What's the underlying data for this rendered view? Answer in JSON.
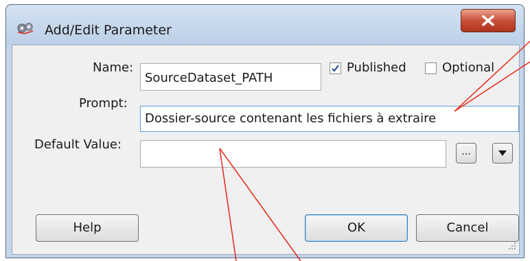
{
  "window": {
    "title": "Add/Edit Parameter",
    "close_glyph": "x"
  },
  "form": {
    "name_label": "Name:",
    "name_value": "SourceDataset_PATH",
    "published_label": "Published",
    "published_checked": true,
    "optional_label": "Optional",
    "optional_checked": false,
    "prompt_label": "Prompt:",
    "prompt_value": "Dossier-source contenant les fichiers à extraire",
    "default_label": "Default Value:",
    "default_value": "",
    "browse_label": "...",
    "dropdown_icon": "triangle-down-icon"
  },
  "buttons": {
    "help": "Help",
    "ok": "OK",
    "cancel": "Cancel"
  },
  "colors": {
    "annotation_line": "#e32619",
    "close_button": "#c9513a",
    "title_bar": "#c5d6ea"
  }
}
